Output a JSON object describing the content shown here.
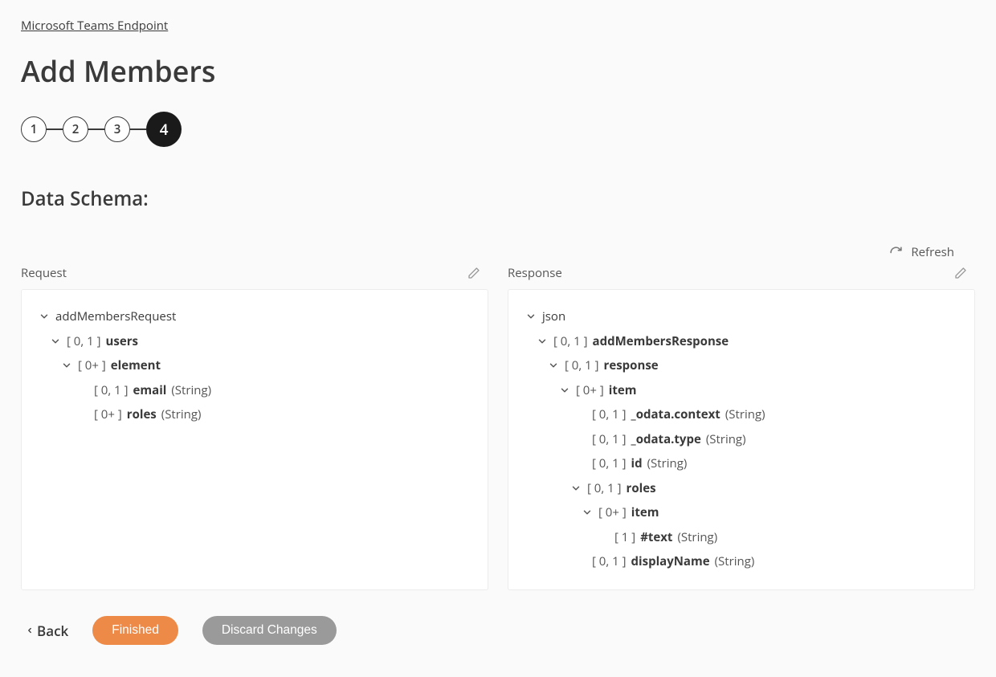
{
  "breadcrumb": "Microsoft Teams Endpoint",
  "page_title": "Add Members",
  "stepper": {
    "steps": [
      "1",
      "2",
      "3",
      "4"
    ],
    "active_index": 3
  },
  "section_title": "Data Schema:",
  "refresh_label": "Refresh",
  "request": {
    "label": "Request",
    "tree": [
      {
        "indent": 0,
        "chevron": true,
        "cardinality": "",
        "name": "addMembersRequest",
        "type": "",
        "bold": false
      },
      {
        "indent": 1,
        "chevron": true,
        "cardinality": "[ 0, 1 ]",
        "name": "users",
        "type": "",
        "bold": true
      },
      {
        "indent": 2,
        "chevron": true,
        "cardinality": "[ 0+ ]",
        "name": "element",
        "type": "",
        "bold": true
      },
      {
        "indent": 3,
        "chevron": false,
        "cardinality": "[ 0, 1 ]",
        "name": "email",
        "type": "(String)",
        "bold": true
      },
      {
        "indent": 3,
        "chevron": false,
        "cardinality": "[ 0+ ]",
        "name": "roles",
        "type": "(String)",
        "bold": true
      }
    ]
  },
  "response": {
    "label": "Response",
    "tree": [
      {
        "indent": 0,
        "chevron": true,
        "cardinality": "",
        "name": "json",
        "type": "",
        "bold": false
      },
      {
        "indent": 1,
        "chevron": true,
        "cardinality": "[ 0, 1 ]",
        "name": "addMembersResponse",
        "type": "",
        "bold": true
      },
      {
        "indent": 2,
        "chevron": true,
        "cardinality": "[ 0, 1 ]",
        "name": "response",
        "type": "",
        "bold": true
      },
      {
        "indent": 3,
        "chevron": true,
        "cardinality": "[ 0+ ]",
        "name": "item",
        "type": "",
        "bold": true
      },
      {
        "indent": 4,
        "chevron": false,
        "cardinality": "[ 0, 1 ]",
        "name": "_odata.context",
        "type": "(String)",
        "bold": true
      },
      {
        "indent": 4,
        "chevron": false,
        "cardinality": "[ 0, 1 ]",
        "name": "_odata.type",
        "type": "(String)",
        "bold": true
      },
      {
        "indent": 4,
        "chevron": false,
        "cardinality": "[ 0, 1 ]",
        "name": "id",
        "type": "(String)",
        "bold": true
      },
      {
        "indent": 4,
        "chevron": true,
        "cardinality": "[ 0, 1 ]",
        "name": "roles",
        "type": "",
        "bold": true
      },
      {
        "indent": 5,
        "chevron": true,
        "cardinality": "[ 0+ ]",
        "name": "item",
        "type": "",
        "bold": true
      },
      {
        "indent": 6,
        "chevron": false,
        "cardinality": "[ 1 ]",
        "name": "#text",
        "type": "(String)",
        "bold": true
      },
      {
        "indent": 4,
        "chevron": false,
        "cardinality": "[ 0, 1 ]",
        "name": "displayName",
        "type": "(String)",
        "bold": true
      }
    ]
  },
  "actions": {
    "back": "Back",
    "finished": "Finished",
    "discard": "Discard Changes"
  }
}
